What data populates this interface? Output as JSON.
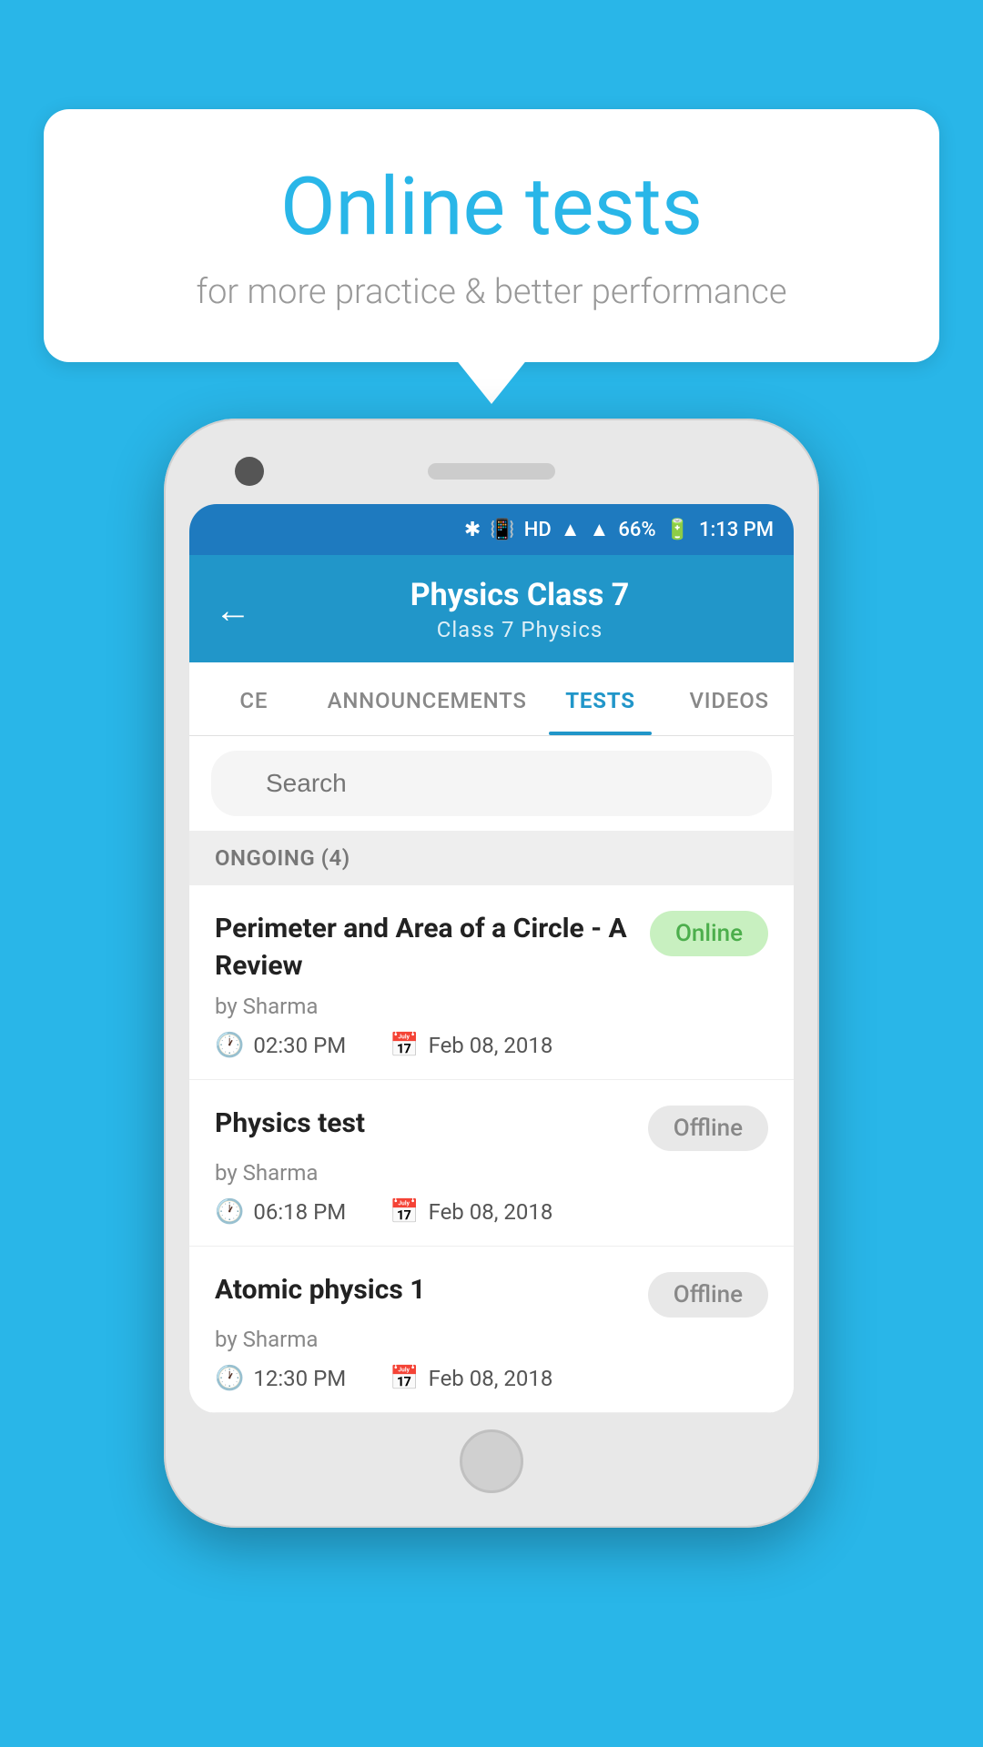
{
  "background_color": "#29b6e8",
  "speech_bubble": {
    "title": "Online tests",
    "subtitle": "for more practice & better performance"
  },
  "status_bar": {
    "battery": "66%",
    "time": "1:13 PM"
  },
  "app_bar": {
    "title": "Physics Class 7",
    "subtitle": "Class 7   Physics",
    "back_icon": "←"
  },
  "tabs": [
    {
      "label": "CE",
      "active": false
    },
    {
      "label": "ANNOUNCEMENTS",
      "active": false
    },
    {
      "label": "TESTS",
      "active": true
    },
    {
      "label": "VIDEOS",
      "active": false
    }
  ],
  "search": {
    "placeholder": "Search"
  },
  "section": {
    "label": "ONGOING (4)"
  },
  "tests": [
    {
      "title": "Perimeter and Area of a Circle - A Review",
      "by": "by Sharma",
      "time": "02:30 PM",
      "date": "Feb 08, 2018",
      "status": "Online",
      "status_type": "online"
    },
    {
      "title": "Physics test",
      "by": "by Sharma",
      "time": "06:18 PM",
      "date": "Feb 08, 2018",
      "status": "Offline",
      "status_type": "offline"
    },
    {
      "title": "Atomic physics 1",
      "by": "by Sharma",
      "time": "12:30 PM",
      "date": "Feb 08, 2018",
      "status": "Offline",
      "status_type": "offline"
    }
  ]
}
